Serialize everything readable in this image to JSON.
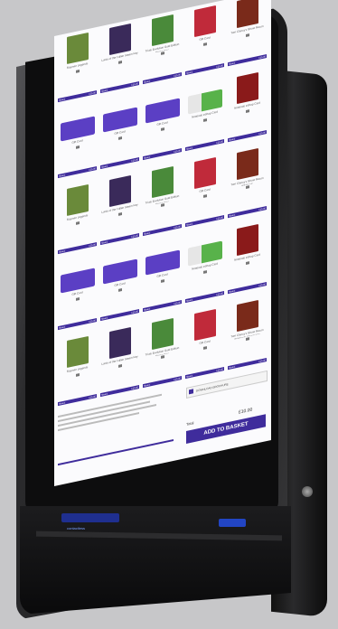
{
  "rows": [
    [
      {
        "kind": "art",
        "color": "#6a8a3a",
        "title": "Rayman Legends"
      },
      {
        "kind": "art",
        "color": "#3a2a5a",
        "title": "Lords of the Fallen Steam Key"
      },
      {
        "kind": "art",
        "color": "#4a8a3a",
        "title": "Trials Evolution Gold Edition Steam Key"
      },
      {
        "kind": "art",
        "color": "#c02a3a",
        "title": "Gift Card"
      },
      {
        "kind": "art",
        "color": "#7a2a1a",
        "title": "Tom Clancy's Ghost Recon"
      }
    ],
    [
      {
        "kind": "gc",
        "title": "Gift Card"
      },
      {
        "kind": "gc",
        "title": "Gift Card"
      },
      {
        "kind": "gc",
        "title": "Gift Card"
      },
      {
        "kind": "gcg",
        "title": "Nintendo eShop Card"
      },
      {
        "kind": "art",
        "color": "#8a1a1a",
        "title": "Nintendo eShop Card"
      }
    ],
    [
      {
        "kind": "art",
        "color": "#6a8a3a",
        "title": "Rayman Legends"
      },
      {
        "kind": "art",
        "color": "#3a2a5a",
        "title": "Lords of the Fallen Steam Key"
      },
      {
        "kind": "art",
        "color": "#4a8a3a",
        "title": "Trials Evolution Gold Edition Steam Key"
      },
      {
        "kind": "art",
        "color": "#c02a3a",
        "title": "Gift Card"
      },
      {
        "kind": "art",
        "color": "#7a2a1a",
        "title": "Tom Clancy's Ghost Recon Wildlands"
      }
    ],
    [
      {
        "kind": "gc",
        "title": "Gift Card"
      },
      {
        "kind": "gc",
        "title": "Gift Card"
      },
      {
        "kind": "gc",
        "title": "Gift Card"
      },
      {
        "kind": "gcg",
        "title": "Nintendo eShop Card"
      },
      {
        "kind": "art",
        "color": "#8a1a1a",
        "title": "Nintendo eShop Card"
      }
    ],
    [
      {
        "kind": "art",
        "color": "#6a8a3a",
        "title": "Rayman Legends"
      },
      {
        "kind": "art",
        "color": "#3a2a5a",
        "title": "Lords of the Fallen Steam Key"
      },
      {
        "kind": "art",
        "color": "#4a8a3a",
        "title": "Trials Evolution Gold Edition Steam Key"
      },
      {
        "kind": "art",
        "color": "#c02a3a",
        "title": "Gift Card"
      },
      {
        "kind": "art",
        "color": "#7a2a1a",
        "title": "Tom Clancy's Ghost Recon Wildlands Steam Key"
      }
    ]
  ],
  "bar_labels": {
    "left": "Steam",
    "right": "£15.00"
  },
  "dropdown_label": "DOWNLOAD BROCHURE",
  "total_label": "Total",
  "total_value": "£10.00",
  "basket_label": "ADD TO BASKET",
  "reader_label": "contactless",
  "colors": {
    "accent": "#3f2c9c",
    "screen": "#fbfbfd"
  }
}
